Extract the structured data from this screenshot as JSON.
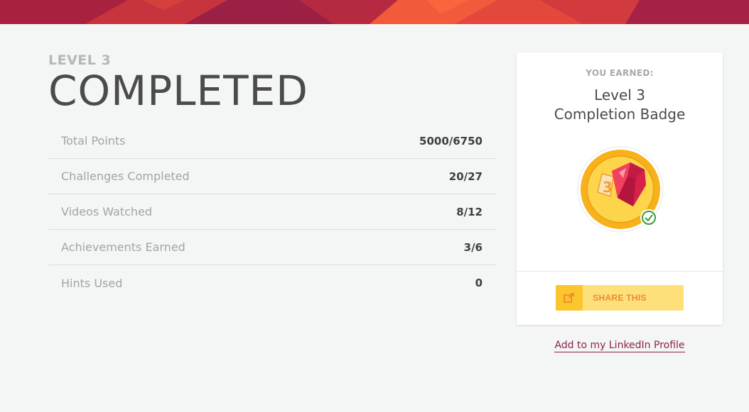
{
  "banner": {
    "colors": [
      "#9c1f45",
      "#c3323f",
      "#e4473b",
      "#f25a3c",
      "#d23b3e",
      "#a62146"
    ]
  },
  "level": {
    "label": "LEVEL 3",
    "title": "COMPLETED"
  },
  "stats": [
    {
      "label": "Total Points",
      "value": "5000/6750"
    },
    {
      "label": "Challenges Completed",
      "value": "20/27"
    },
    {
      "label": "Videos Watched",
      "value": "8/12"
    },
    {
      "label": "Achievements Earned",
      "value": "3/6"
    },
    {
      "label": "Hints Used",
      "value": "0"
    }
  ],
  "card": {
    "earned_label": "YOU EARNED:",
    "badge_title_line1": "Level 3",
    "badge_title_line2": "Completion Badge",
    "badge_number": "3",
    "badge_icon": "gem-badge-icon",
    "check_icon": "checkmark-icon",
    "share_label": "SHARE THIS",
    "share_icon": "share-icon"
  },
  "linkedin": {
    "label": "Add to my LinkedIn Profile"
  },
  "colors": {
    "accent_gold": "#fbc52e",
    "share_bg": "#fde07a",
    "share_text": "#ee8a2f",
    "link": "#8a2450",
    "check_green": "#3a9a3a"
  }
}
